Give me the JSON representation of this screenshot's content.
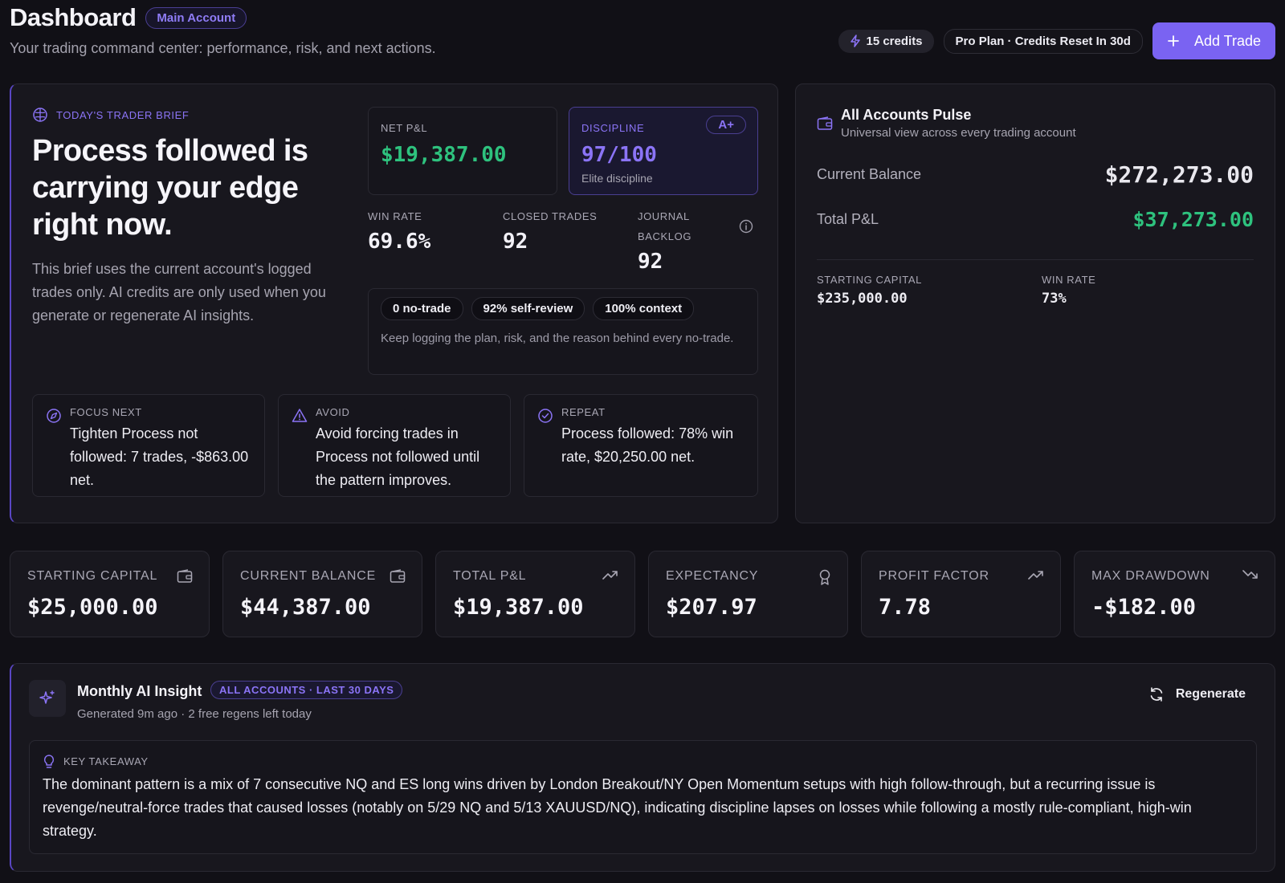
{
  "header": {
    "title": "Dashboard",
    "account_badge": "Main Account",
    "subtitle": "Your trading command center: performance, risk, and next actions.",
    "credits": "15 credits",
    "plan": "Pro Plan · Credits Reset In 30d",
    "add_trade_label": "Add Trade"
  },
  "brief": {
    "tag": "TODAY'S TRADER BRIEF",
    "headline": "Process followed is carrying your edge right now.",
    "body": "This brief uses the current account's logged trades only. AI credits are only used when you generate or regenerate AI insights.",
    "net_pl": {
      "label": "NET P&L",
      "value": "$19,387.00"
    },
    "discipline": {
      "label": "DISCIPLINE",
      "grade": "A+",
      "value": "97/100",
      "sub": "Elite discipline"
    },
    "stats": [
      {
        "label": "WIN RATE",
        "value": "69.6%"
      },
      {
        "label": "CLOSED TRADES",
        "value": "92"
      },
      {
        "label": "JOURNAL BACKLOG",
        "value": "92"
      }
    ],
    "chips": [
      "0 no-trade",
      "92% self-review",
      "100% context"
    ],
    "context_text": "Keep logging the plan, risk, and the reason behind every no-trade.",
    "focus": [
      {
        "label": "FOCUS NEXT",
        "text": "Tighten Process not followed: 7 trades, -$863.00 net."
      },
      {
        "label": "AVOID",
        "text": "Avoid forcing trades in Process not followed until the pattern improves."
      },
      {
        "label": "REPEAT",
        "text": "Process followed: 78% win rate, $20,250.00 net."
      }
    ]
  },
  "pulse": {
    "title": "All Accounts Pulse",
    "subtitle": "Universal view across every trading account",
    "current_balance_label": "Current Balance",
    "current_balance": "$272,273.00",
    "total_pl_label": "Total P&L",
    "total_pl": "$37,273.00",
    "starting_capital_label": "STARTING CAPITAL",
    "starting_capital": "$235,000.00",
    "win_rate_label": "WIN RATE",
    "win_rate": "73%"
  },
  "kpis": [
    {
      "label": "STARTING CAPITAL",
      "value": "$25,000.00",
      "icon": "wallet-icon",
      "tone": "neutral"
    },
    {
      "label": "CURRENT BALANCE",
      "value": "$44,387.00",
      "icon": "wallet-icon",
      "tone": "neutral"
    },
    {
      "label": "TOTAL P&L",
      "value": "$19,387.00",
      "icon": "trending-up-icon",
      "tone": "positive"
    },
    {
      "label": "EXPECTANCY",
      "value": "$207.97",
      "icon": "award-icon",
      "tone": "positive"
    },
    {
      "label": "PROFIT FACTOR",
      "value": "7.78",
      "icon": "trending-up-icon",
      "tone": "positive"
    },
    {
      "label": "MAX DRAWDOWN",
      "value": "-$182.00",
      "icon": "trending-down-icon",
      "tone": "negative"
    }
  ],
  "insight": {
    "title": "Monthly AI Insight",
    "badge": "ALL ACCOUNTS · LAST 30 DAYS",
    "generated": "Generated 9m ago · 2 free regens left today",
    "regenerate_label": "Regenerate",
    "takeaway_label": "KEY TAKEAWAY",
    "takeaway": "The dominant pattern is a mix of 7 consecutive NQ and ES long wins driven by London Breakout/NY Open Momentum setups with high follow-through, but a recurring issue is revenge/neutral-force trades that caused losses (notably on 5/29 NQ and 5/13 XAUUSD/NQ), indicating discipline lapses on losses while following a mostly rule-compliant, high-win strategy."
  },
  "colors": {
    "accent": "#7a63f2",
    "positive": "#2ec27e",
    "negative": "#ef4444",
    "background": "#111016",
    "card": "#18171e"
  }
}
